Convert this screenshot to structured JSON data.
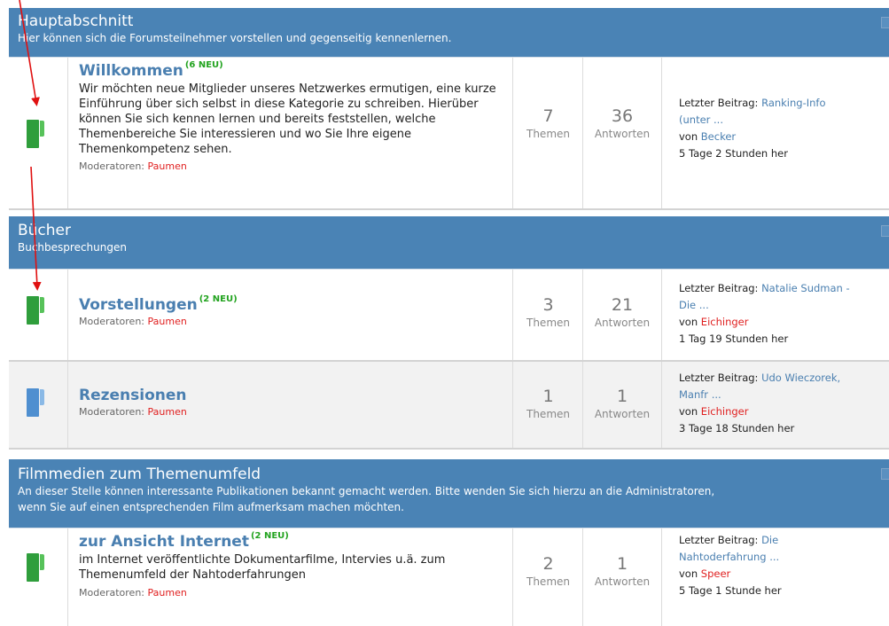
{
  "sections": [
    {
      "title": "Hauptabschnitt",
      "description": "Hier können sich die Forumsteilnehmer vorstellen und gegenseitig kennenlernen.",
      "forums": [
        {
          "title": "Willkommen",
          "new_badge": "(6 NEU)",
          "description": "Wir möchten neue Mitglieder unseres Netzwerkes ermutigen, eine kurze Einführung über sich selbst in diese Kategorie zu schreiben. Hierüber können Sie sich kennen lernen und bereits feststellen, welche Themenbereiche Sie interessieren und wo Sie Ihre eigene Themenkompetenz sehen.",
          "moderators_label": "Moderatoren:",
          "moderator": "Paumen",
          "topics": "7",
          "topics_label": "Themen",
          "replies": "36",
          "replies_label": "Antworten",
          "last_label": "Letzter Beitrag:",
          "last_title_1": "Ranking-Info",
          "last_title_2": "(unter ...",
          "by_label": "von",
          "last_user": "Becker",
          "last_time": "5 Tage 2 Stunden her",
          "icon_color": "green"
        }
      ]
    },
    {
      "title": "Bücher",
      "description": "Buchbesprechungen",
      "forums": [
        {
          "title": "Vorstellungen",
          "new_badge": "(2 NEU)",
          "moderators_label": "Moderatoren:",
          "moderator": "Paumen",
          "topics": "3",
          "topics_label": "Themen",
          "replies": "21",
          "replies_label": "Antworten",
          "last_label": "Letzter Beitrag:",
          "last_title_1": "Natalie Sudman -",
          "last_title_2": "Die ...",
          "by_label": "von",
          "last_user": "Eichinger",
          "last_time": "1 Tag 19 Stunden her",
          "icon_color": "green"
        },
        {
          "title": "Rezensionen",
          "moderators_label": "Moderatoren:",
          "moderator": "Paumen",
          "topics": "1",
          "topics_label": "Themen",
          "replies": "1",
          "replies_label": "Antworten",
          "last_label": "Letzter Beitrag:",
          "last_title_1": "Udo Wieczorek,",
          "last_title_2": "Manfr ...",
          "by_label": "von",
          "last_user": "Eichinger",
          "last_time": "3 Tage 18 Stunden her",
          "icon_color": "blue"
        }
      ]
    },
    {
      "title": "Filmmedien zum Themenumfeld",
      "description_1": "An dieser Stelle können interessante Publikationen bekannt gemacht werden. Bitte wenden Sie sich hierzu an die Administratoren,",
      "description_2": "wenn Sie auf einen entsprechenden Film aufmerksam machen möchten.",
      "forums": [
        {
          "title": "zur Ansicht Internet",
          "new_badge": "(2 NEU)",
          "description": "im Internet veröffentlichte Dokumentarfilme, Intervies u.ä. zum Themenumfeld der Nahtoderfahrungen",
          "moderators_label": "Moderatoren:",
          "moderator": "Paumen",
          "topics": "2",
          "topics_label": "Themen",
          "replies": "1",
          "replies_label": "Antworten",
          "last_label": "Letzter Beitrag:",
          "last_title_1": "Die",
          "last_title_2": "Nahtoderfahrung ...",
          "by_label": "von",
          "last_user": "Speer",
          "last_time": "5 Tage 1 Stunde her",
          "icon_color": "green"
        }
      ]
    }
  ],
  "colors": {
    "header_bg": "#4a83b5",
    "link": "#4a7fb0",
    "new_badge": "#22a31f",
    "moderator": "#e02020",
    "folder_green": "#2f9e3c",
    "folder_blue": "#4f8fd0",
    "annotation_arrow": "#e01010"
  },
  "icons": [
    "folder-icon",
    "collapse-icon",
    "annotation-arrow"
  ]
}
